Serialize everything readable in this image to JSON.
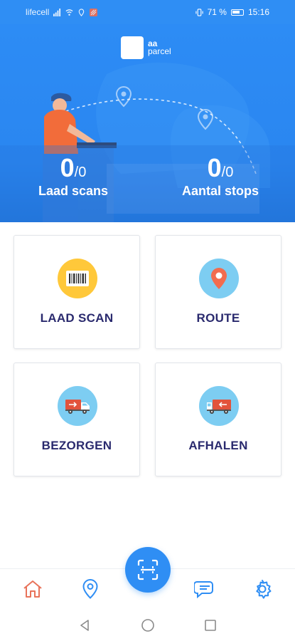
{
  "status_bar": {
    "carrier": "lifecell",
    "battery": "71 %",
    "time": "15:16"
  },
  "brand": {
    "name_line1": "aa",
    "name_line2": "parcel"
  },
  "stats": [
    {
      "value": "0",
      "total": "/0",
      "label": "Laad scans"
    },
    {
      "value": "0",
      "total": "/0",
      "label": "Aantal stops"
    }
  ],
  "cards": [
    {
      "label": "LAAD SCAN",
      "icon": "barcode-icon"
    },
    {
      "label": "ROUTE",
      "icon": "map-pin-icon"
    },
    {
      "label": "BEZORGEN",
      "icon": "delivery-truck-icon"
    },
    {
      "label": "AFHALEN",
      "icon": "pickup-truck-icon"
    }
  ],
  "bottom_nav": [
    "home-icon",
    "location-icon",
    "scan-icon",
    "chat-icon",
    "settings-icon"
  ],
  "colors": {
    "primary": "#2f8ef4",
    "home_active": "#e8735a",
    "card_text": "#2a2a6e",
    "yellow_badge": "#ffc83a",
    "blue_badge": "#7dcdf2"
  }
}
